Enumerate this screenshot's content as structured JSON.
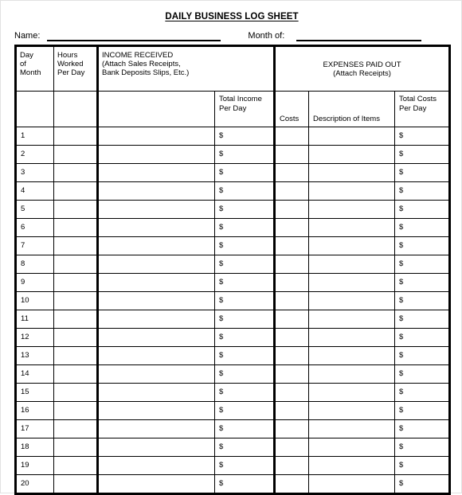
{
  "document": {
    "title": "DAILY BUSINESS LOG SHEET"
  },
  "identity": {
    "name_label": "Name:",
    "name_value": "",
    "month_label": "Month of:",
    "month_value": ""
  },
  "table": {
    "group_headers": {
      "day_of_month": "Day\nof\nMonth",
      "day_of_month_lines": [
        "Day",
        "of",
        "Month"
      ],
      "hours_worked": "Hours\nWorked\nPer Day",
      "hours_worked_lines": [
        "Hours",
        "Worked",
        "Per Day"
      ],
      "income_received_title": "INCOME RECEIVED",
      "income_received_sub1": "(Attach Sales Receipts,",
      "income_received_sub2": "Bank Deposits Slips, Etc.)",
      "expenses_title": "EXPENSES PAID OUT",
      "expenses_sub": "(Attach Receipts)"
    },
    "sub_headers": {
      "day_blank": "",
      "hours_blank": "",
      "income_detail_blank": "",
      "total_income_line1": "Total Income",
      "total_income_line2": "Per Day",
      "costs": "Costs",
      "description_of_items": "Description of Items",
      "total_costs_line1": "Total Costs",
      "total_costs_line2": "Per Day"
    },
    "currency_symbol": "$",
    "rows": [
      {
        "day": "1",
        "hours": "",
        "income_detail": "",
        "total_income": "$",
        "costs": "",
        "description": "",
        "total_costs": "$"
      },
      {
        "day": "2",
        "hours": "",
        "income_detail": "",
        "total_income": "$",
        "costs": "",
        "description": "",
        "total_costs": "$"
      },
      {
        "day": "3",
        "hours": "",
        "income_detail": "",
        "total_income": "$",
        "costs": "",
        "description": "",
        "total_costs": "$"
      },
      {
        "day": "4",
        "hours": "",
        "income_detail": "",
        "total_income": "$",
        "costs": "",
        "description": "",
        "total_costs": "$"
      },
      {
        "day": "5",
        "hours": "",
        "income_detail": "",
        "total_income": "$",
        "costs": "",
        "description": "",
        "total_costs": "$"
      },
      {
        "day": "6",
        "hours": "",
        "income_detail": "",
        "total_income": "$",
        "costs": "",
        "description": "",
        "total_costs": "$"
      },
      {
        "day": "7",
        "hours": "",
        "income_detail": "",
        "total_income": "$",
        "costs": "",
        "description": "",
        "total_costs": "$"
      },
      {
        "day": "8",
        "hours": "",
        "income_detail": "",
        "total_income": "$",
        "costs": "",
        "description": "",
        "total_costs": "$"
      },
      {
        "day": "9",
        "hours": "",
        "income_detail": "",
        "total_income": "$",
        "costs": "",
        "description": "",
        "total_costs": "$"
      },
      {
        "day": "10",
        "hours": "",
        "income_detail": "",
        "total_income": "$",
        "costs": "",
        "description": "",
        "total_costs": "$"
      },
      {
        "day": "11",
        "hours": "",
        "income_detail": "",
        "total_income": "$",
        "costs": "",
        "description": "",
        "total_costs": "$"
      },
      {
        "day": "12",
        "hours": "",
        "income_detail": "",
        "total_income": "$",
        "costs": "",
        "description": "",
        "total_costs": "$"
      },
      {
        "day": "13",
        "hours": "",
        "income_detail": "",
        "total_income": "$",
        "costs": "",
        "description": "",
        "total_costs": "$"
      },
      {
        "day": "14",
        "hours": "",
        "income_detail": "",
        "total_income": "$",
        "costs": "",
        "description": "",
        "total_costs": "$"
      },
      {
        "day": "15",
        "hours": "",
        "income_detail": "",
        "total_income": "$",
        "costs": "",
        "description": "",
        "total_costs": "$"
      },
      {
        "day": "16",
        "hours": "",
        "income_detail": "",
        "total_income": "$",
        "costs": "",
        "description": "",
        "total_costs": "$"
      },
      {
        "day": "17",
        "hours": "",
        "income_detail": "",
        "total_income": "$",
        "costs": "",
        "description": "",
        "total_costs": "$"
      },
      {
        "day": "18",
        "hours": "",
        "income_detail": "",
        "total_income": "$",
        "costs": "",
        "description": "",
        "total_costs": "$"
      },
      {
        "day": "19",
        "hours": "",
        "income_detail": "",
        "total_income": "$",
        "costs": "",
        "description": "",
        "total_costs": "$"
      },
      {
        "day": "20",
        "hours": "",
        "income_detail": "",
        "total_income": "$",
        "costs": "",
        "description": "",
        "total_costs": "$"
      }
    ]
  },
  "colors": {
    "ink": "#000000",
    "paper": "#ffffff",
    "page_border": "#e2e2e2"
  }
}
